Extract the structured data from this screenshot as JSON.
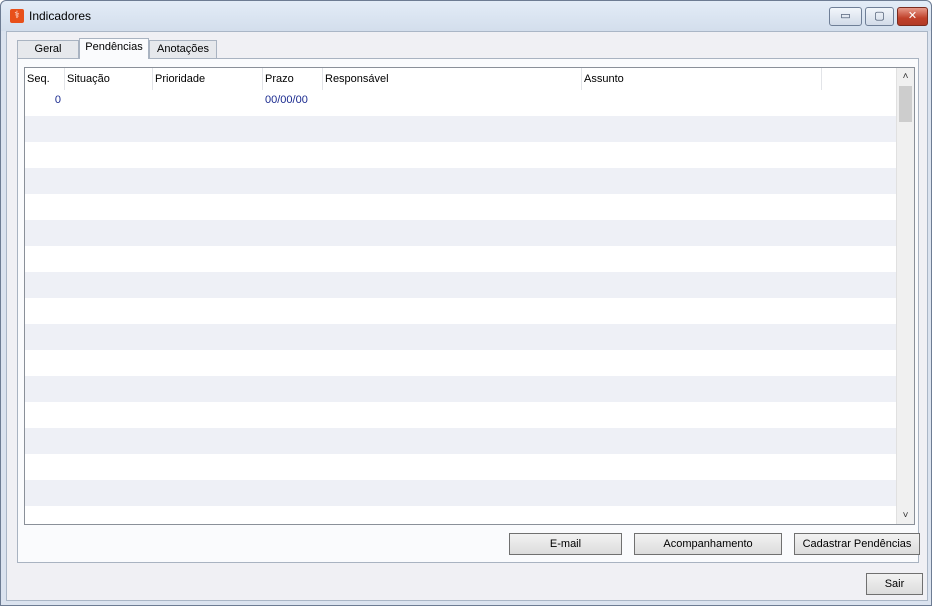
{
  "window": {
    "title": "Indicadores",
    "app_icon": "pharmacy-logo-icon",
    "minimize": "▭",
    "maximize": "▢",
    "close": "✕"
  },
  "tabs": [
    {
      "label": "Geral",
      "active": false
    },
    {
      "label": "Pendências",
      "active": true
    },
    {
      "label": "Anotações",
      "active": false
    }
  ],
  "grid": {
    "columns": [
      "Seq.",
      "Situação",
      "Prioridade",
      "Prazo",
      "Responsável",
      "Assunto",
      ""
    ],
    "rows": [
      {
        "seq": "0",
        "situacao": "",
        "prioridade": "",
        "prazo": "00/00/00",
        "responsavel": "",
        "assunto": ""
      }
    ],
    "scroll_up": "˄",
    "scroll_down": "˅"
  },
  "actions": {
    "email": "E-mail",
    "acompanhamento": "Acompanhamento",
    "cadastrar": "Cadastrar Pendências",
    "sair": "Sair"
  },
  "colors": {
    "accent_text": "#1a2a8f",
    "row_alt": "#eef0f6"
  }
}
